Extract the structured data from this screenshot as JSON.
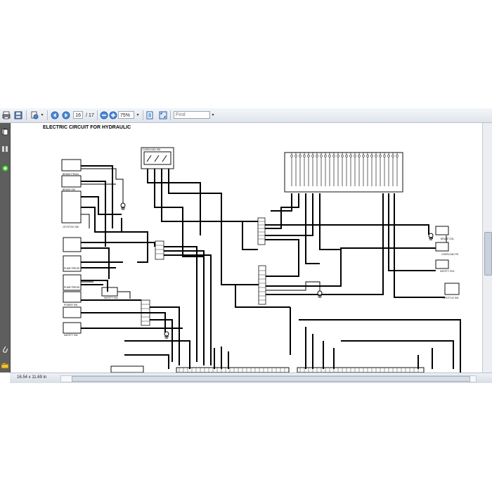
{
  "toolbar": {
    "page_current": "16",
    "page_total": "/ 17",
    "zoom": "75%",
    "find_placeholder": "Find"
  },
  "document": {
    "title": "ELECTRIC CIRCUIT FOR HYDRAULIC",
    "labels": {
      "overload_sw": "OVERLOAD SW",
      "brake_pedal": "BRAKE PEDAL",
      "brake_sw": "BRAKE SW",
      "joystick_sw": "JOYSTICK SW",
      "pump_press1": "PUMP PRESS",
      "pump_press2": "PUMP PRESS",
      "safety_sw_a": "SAFETY SW",
      "power_sw": "POWER SW",
      "safety_sw_b": "SAFETY SW",
      "brake_sol": "BRAKE SOL",
      "overload_ps": "OVERLOAD PS",
      "safety_sol": "SAFETY SOL",
      "throttle_sw": "THROTTLE SW"
    }
  },
  "status": {
    "page_size": "16.54 x 11.69 in"
  }
}
